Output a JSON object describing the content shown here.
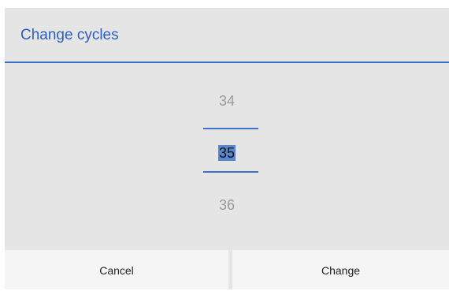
{
  "dialog": {
    "title": "Change cycles"
  },
  "picker": {
    "previous": "34",
    "current": "35",
    "next": "36"
  },
  "buttons": {
    "cancel": "Cancel",
    "confirm": "Change"
  },
  "colors": {
    "accent": "#2c5fbf",
    "selection": "#5a85cf",
    "dialog_background": "#e5e5e5"
  }
}
